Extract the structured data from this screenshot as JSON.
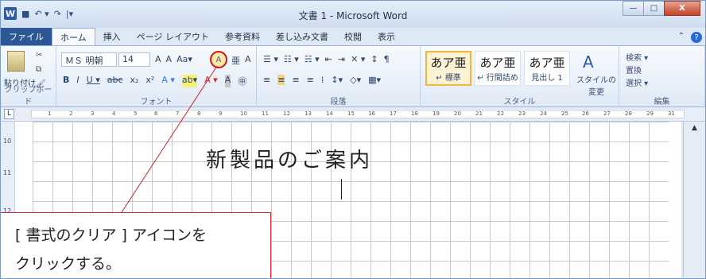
{
  "window": {
    "title": "文書 1 - Microsoft Word",
    "qat": {
      "logo": "W",
      "save": "■",
      "undo": "↶ ▾",
      "redo": "↷",
      "customize": "|▾"
    },
    "controls": {
      "minimize": "—",
      "maximize": "□",
      "close": "X"
    }
  },
  "tabs": {
    "file": "ファイル",
    "items": [
      "ホーム",
      "挿入",
      "ページ レイアウト",
      "参考資料",
      "差し込み文書",
      "校閲",
      "表示"
    ],
    "active_index": 0,
    "collapse": "⌃",
    "help": "?"
  },
  "ribbon": {
    "clipboard": {
      "label": "クリップボード",
      "paste": "貼り付け"
    },
    "font": {
      "label": "フォント",
      "font_name": "ＭＳ 明朝",
      "font_size": "14",
      "row1_icons": [
        "A",
        "A",
        "Aa▾"
      ],
      "clear_icon": "A",
      "row1_tail": [
        "亜",
        "A"
      ],
      "row2_icons": [
        "B",
        "I",
        "U ▾",
        "abc",
        "x₂",
        "x²",
        "A ▾",
        "ab▾",
        "A ▾",
        "A",
        "㊥"
      ]
    },
    "paragraph": {
      "label": "段落",
      "row1": [
        "☰ ▾",
        "☷ ▾",
        "☵ ▾",
        "⇤",
        "⇥",
        "✕ ▾",
        "↕",
        "¶"
      ],
      "row2": [
        "≡",
        "≡",
        "≡",
        "≡",
        "⁞",
        "↕▾",
        "◇▾",
        "▦▾"
      ]
    },
    "styles": {
      "label": "スタイル",
      "items": [
        {
          "preview": "あア亜",
          "name": "↵ 標準"
        },
        {
          "preview": "あア亜",
          "name": "↵ 行間詰め"
        },
        {
          "preview": "あア亜",
          "name": "見出し 1"
        }
      ],
      "change": "スタイルの変更"
    },
    "editing": {
      "label": "編集",
      "find": "検索 ▾",
      "replace": "置換",
      "select": "選択 ▾"
    }
  },
  "ruler": {
    "corner": "L",
    "ticks": [
      "1",
      "2",
      "3",
      "4",
      "5",
      "6",
      "7",
      "8",
      "9",
      "10",
      "11",
      "12",
      "13",
      "14",
      "15",
      "16",
      "17",
      "18",
      "19",
      "20",
      "21",
      "22",
      "23",
      "24",
      "25",
      "26",
      "27",
      "28",
      "29",
      "31"
    ]
  },
  "vruler": {
    "ticks": [
      "10",
      "11",
      "12"
    ]
  },
  "document": {
    "heading": "新製品のご案内"
  },
  "callout": {
    "line1": "[ 書式のクリア ] アイコンを",
    "line2": "クリックする。"
  },
  "accent": {
    "file_tab": "#2b5797",
    "callout_border": "#d8222a",
    "selected_style": "#f2b540"
  }
}
